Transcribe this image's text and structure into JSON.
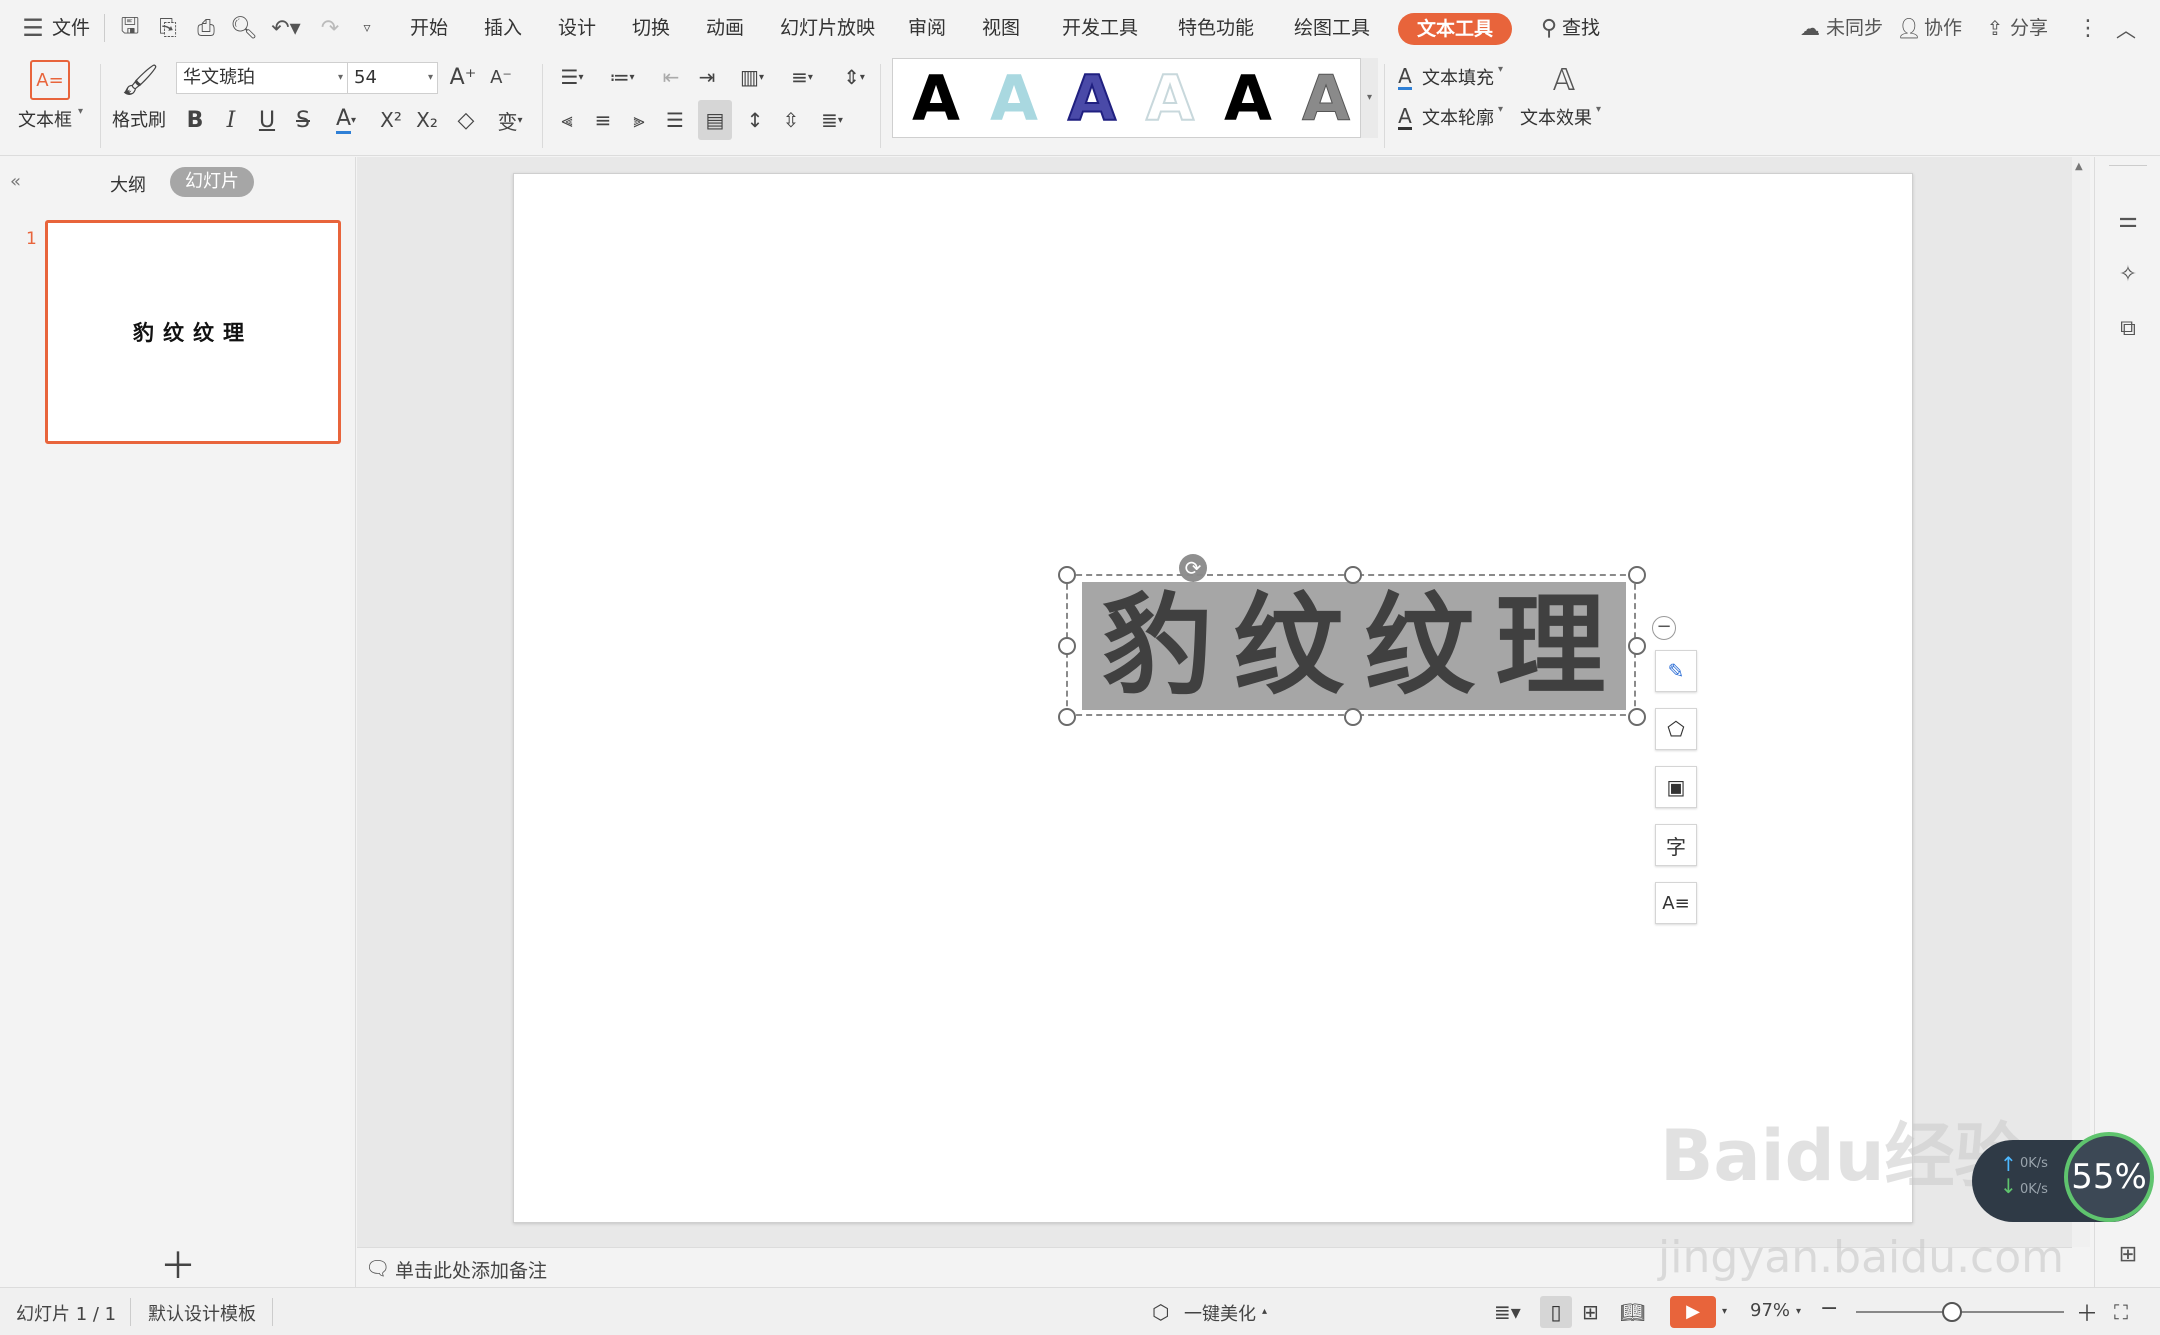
{
  "menubar": {
    "file_label": "文件",
    "tabs": [
      "开始",
      "插入",
      "设计",
      "切换",
      "动画",
      "幻灯片放映",
      "审阅",
      "视图",
      "开发工具",
      "特色功能",
      "绘图工具",
      "文本工具"
    ],
    "active_tab": "文本工具",
    "search_label": "查找",
    "sync_label": "未同步",
    "collab_label": "协作",
    "share_label": "分享"
  },
  "ribbon": {
    "textbox_label": "文本框",
    "format_painter_label": "格式刷",
    "font_name": "华文琥珀",
    "font_size": "54",
    "text_fill_label": "文本填充",
    "text_outline_label": "文本轮廓",
    "text_effect_label": "文本效果",
    "gallery_letter": "A"
  },
  "left_panel": {
    "tab_outline": "大纲",
    "tab_slides": "幻灯片",
    "slide_number": "1",
    "thumb_text": "豹纹纹理"
  },
  "slide": {
    "title_chars": [
      "豹",
      "纹",
      "纹",
      "理"
    ]
  },
  "notes": {
    "placeholder": "单击此处添加备注"
  },
  "statusbar": {
    "slide_info": "幻灯片 1 / 1",
    "template": "默认设计模板",
    "beautify": "一键美化",
    "zoom": "97%"
  },
  "overlay": {
    "net_percent": "55%",
    "speed_up": "0K/s",
    "speed_down": "0K/s",
    "watermark": "Baidu经验",
    "watermark_url": "jingyan.baidu.com"
  },
  "colors": {
    "accent": "#e8643b",
    "text_gray": "#404040",
    "textbox_fill": "#a6a6a6"
  }
}
